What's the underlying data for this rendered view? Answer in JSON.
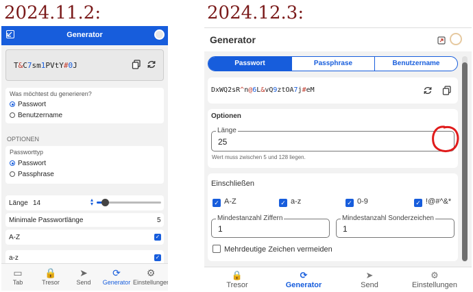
{
  "versions": {
    "old": "2024.11.2:",
    "new": "2024.12.3:"
  },
  "old": {
    "header_title": "Generator",
    "password": [
      {
        "t": "T",
        "c": "#222"
      },
      {
        "t": "&",
        "c": "#c0392b"
      },
      {
        "t": "C",
        "c": "#222"
      },
      {
        "t": "7",
        "c": "#175ddc"
      },
      {
        "t": "sm",
        "c": "#222"
      },
      {
        "t": "1",
        "c": "#175ddc"
      },
      {
        "t": "PVtY",
        "c": "#222"
      },
      {
        "t": "#",
        "c": "#c0392b"
      },
      {
        "t": "0",
        "c": "#175ddc"
      },
      {
        "t": "J",
        "c": "#222"
      }
    ],
    "question": "Was möchtest du generieren?",
    "type_options": [
      "Passwort",
      "Benutzername"
    ],
    "options_heading": "OPTIONEN",
    "password_type_label": "Passworttyp",
    "password_type_options": [
      "Passwort",
      "Passphrase"
    ],
    "length_label": "Länge",
    "length_value": "14",
    "length_fraction": 0.08,
    "min_length_label": "Minimale Passwortlänge",
    "min_length_value": "5",
    "az_upper_label": "A-Z",
    "az_lower_label": "a-z",
    "nav": [
      "Tab",
      "Tresor",
      "Send",
      "Generator",
      "Einstellungen"
    ]
  },
  "new": {
    "header_title": "Generator",
    "tabs": [
      "Passwort",
      "Passphrase",
      "Benutzername"
    ],
    "password": [
      {
        "t": "DxWQ2sR",
        "c": "#222"
      },
      {
        "t": "^",
        "c": "#c0392b"
      },
      {
        "t": "n",
        "c": "#222"
      },
      {
        "t": "@",
        "c": "#c0392b"
      },
      {
        "t": "6",
        "c": "#175ddc"
      },
      {
        "t": "L",
        "c": "#222"
      },
      {
        "t": "&",
        "c": "#c0392b"
      },
      {
        "t": "vQ",
        "c": "#222"
      },
      {
        "t": "9",
        "c": "#175ddc"
      },
      {
        "t": "ztOA",
        "c": "#222"
      },
      {
        "t": "7",
        "c": "#175ddc"
      },
      {
        "t": "j",
        "c": "#222"
      },
      {
        "t": "#",
        "c": "#c0392b"
      },
      {
        "t": "eM",
        "c": "#222"
      }
    ],
    "options_heading": "Optionen",
    "length_label": "Länge",
    "length_value": "25",
    "length_hint": "Wert muss zwischen 5 und 128 liegen.",
    "include_heading": "Einschließen",
    "include_options": [
      "A-Z",
      "a-z",
      "0-9",
      "!@#^&*"
    ],
    "min_digits_label": "Mindestanzahl Ziffern",
    "min_digits_value": "1",
    "min_special_label": "Mindestanzahl Sonderzeichen",
    "min_special_value": "1",
    "avoid_ambiguous_label": "Mehrdeutige Zeichen vermeiden",
    "nav": [
      "Tresor",
      "Generator",
      "Send",
      "Einstellungen"
    ]
  }
}
